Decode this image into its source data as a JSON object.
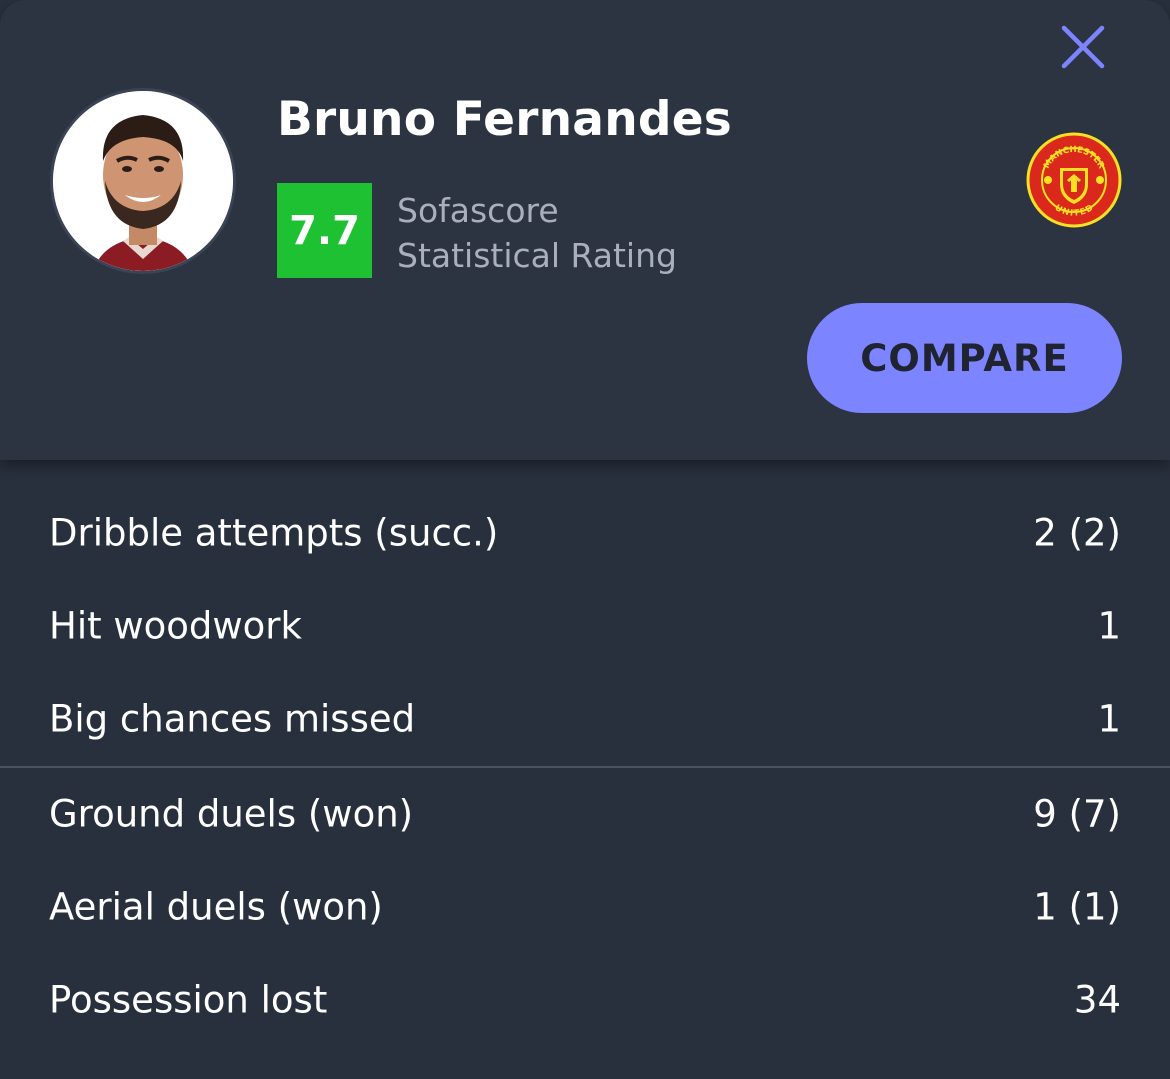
{
  "player": {
    "name": "Bruno Fernandes",
    "rating": "7.7",
    "rating_caption_line1": "Sofascore",
    "rating_caption_line2": "Statistical Rating",
    "club_crest_text_top": "MANCHESTER",
    "club_crest_text_bottom": "UNITED"
  },
  "actions": {
    "compare_label": "COMPARE",
    "close_icon": "close-icon"
  },
  "colors": {
    "background": "#28303d",
    "header": "#2c3442",
    "rating_green": "#1ec132",
    "accent": "#7c85ff",
    "crest_red": "#da291c",
    "crest_gold": "#fbe122"
  },
  "stats_group_1": [
    {
      "label": "Dribble attempts (succ.)",
      "value": "2 (2)"
    },
    {
      "label": "Hit woodwork",
      "value": "1"
    },
    {
      "label": "Big chances missed",
      "value": "1"
    }
  ],
  "stats_group_2": [
    {
      "label": "Ground duels (won)",
      "value": "9 (7)"
    },
    {
      "label": "Aerial duels (won)",
      "value": "1 (1)"
    },
    {
      "label": "Possession lost",
      "value": "34"
    }
  ]
}
